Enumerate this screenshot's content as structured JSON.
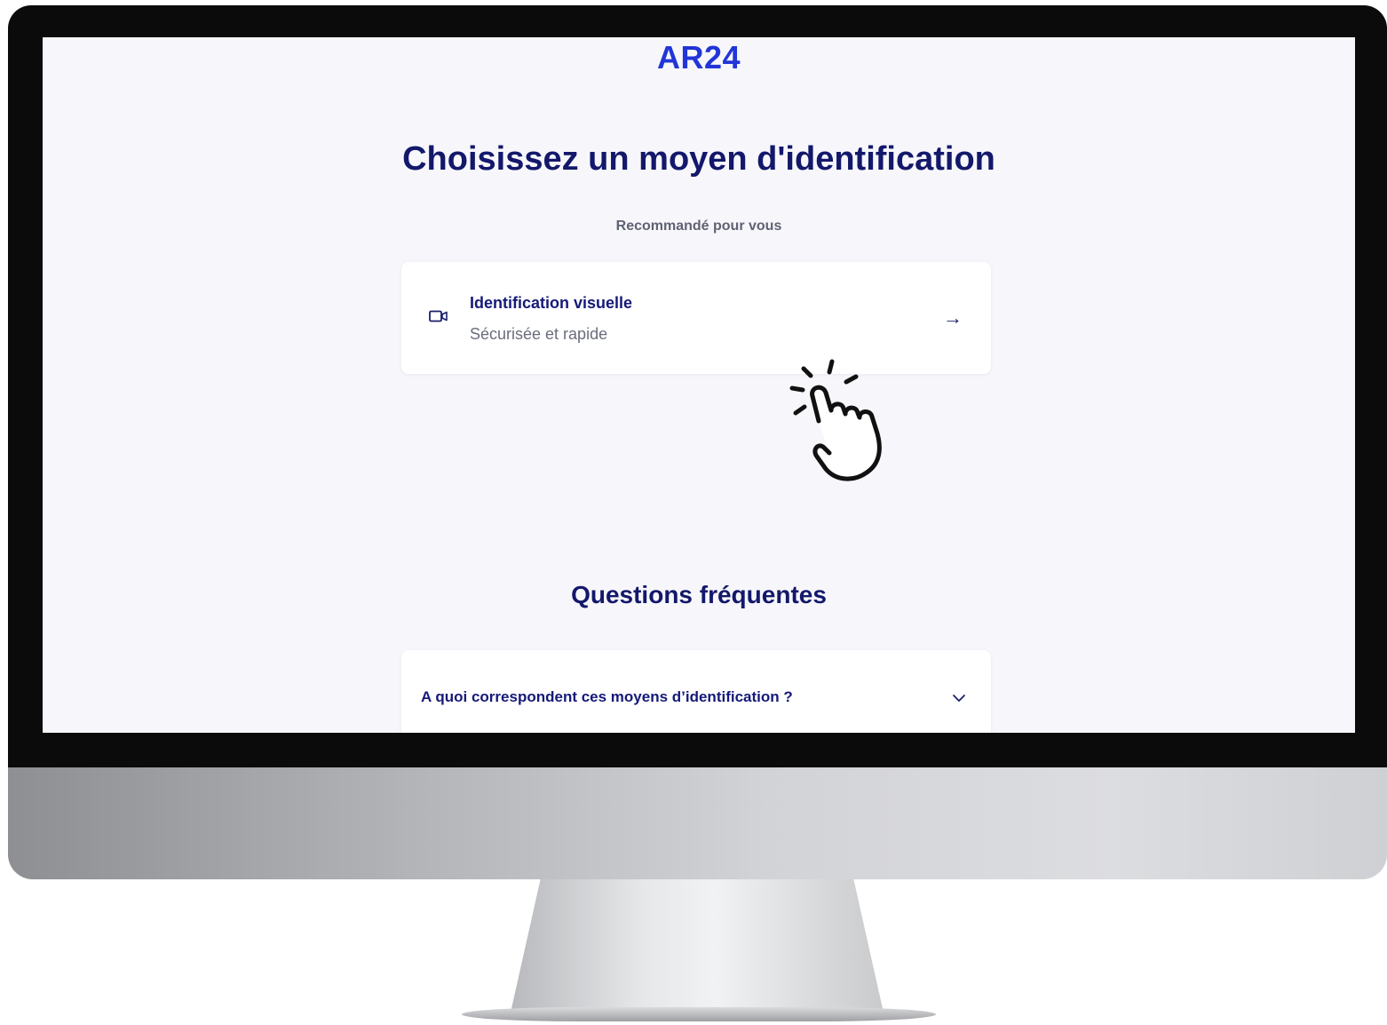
{
  "brand": {
    "logo": "AR24",
    "accent": "#2235d8",
    "navy": "#13186b"
  },
  "main": {
    "title": "Choisissez un moyen d'identification",
    "recommended_label": "Recommandé pour vous",
    "option": {
      "icon": "video-camera-icon",
      "title": "Identification visuelle",
      "subtitle": "Sécurisée et rapide",
      "arrow": "→"
    }
  },
  "faq": {
    "title": "Questions fréquentes",
    "items": [
      {
        "question": "A quoi correspondent ces moyens d’identification ?",
        "icon": "chevron-down-icon"
      }
    ]
  },
  "overlay": {
    "icon": "hand-pointer-icon"
  }
}
